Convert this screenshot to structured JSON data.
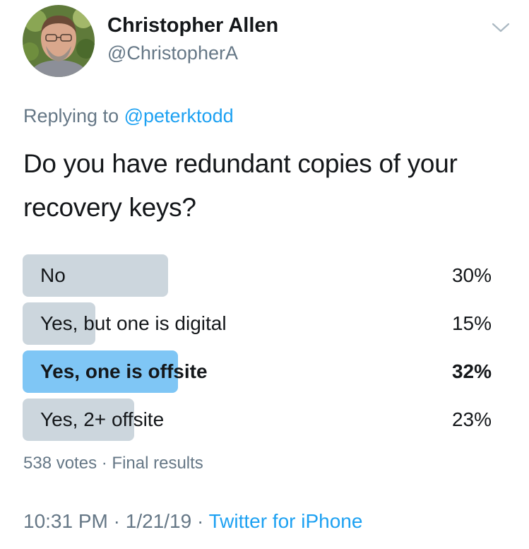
{
  "author": {
    "name": "Christopher Allen",
    "handle": "@ChristopherA",
    "avatar_icon": "profile-photo"
  },
  "header": {
    "menu_icon": "chevron-down-icon"
  },
  "reply": {
    "prefix": "Replying to",
    "mention": "@peterktodd"
  },
  "tweet": {
    "text": "Do you have redundant copies of your recovery keys?"
  },
  "poll": {
    "options": [
      {
        "label": "No",
        "percent_text": "30%",
        "percent": 30,
        "winner": false
      },
      {
        "label": "Yes, but one is digital",
        "percent_text": "15%",
        "percent": 15,
        "winner": false
      },
      {
        "label": "Yes, one is offsite",
        "percent_text": "32%",
        "percent": 32,
        "winner": true
      },
      {
        "label": "Yes, 2+ offsite",
        "percent_text": "23%",
        "percent": 23,
        "winner": false
      }
    ],
    "votes": "538 votes",
    "separator": "·",
    "status": "Final results"
  },
  "meta": {
    "time": "10:31 PM",
    "separator": "·",
    "date": "1/21/19",
    "source": "Twitter for iPhone"
  },
  "colors": {
    "text": "#14171a",
    "secondary": "#657786",
    "link": "#1da1f2",
    "bar": "#ccd6dd",
    "bar_winner": "#7fc6f5"
  }
}
